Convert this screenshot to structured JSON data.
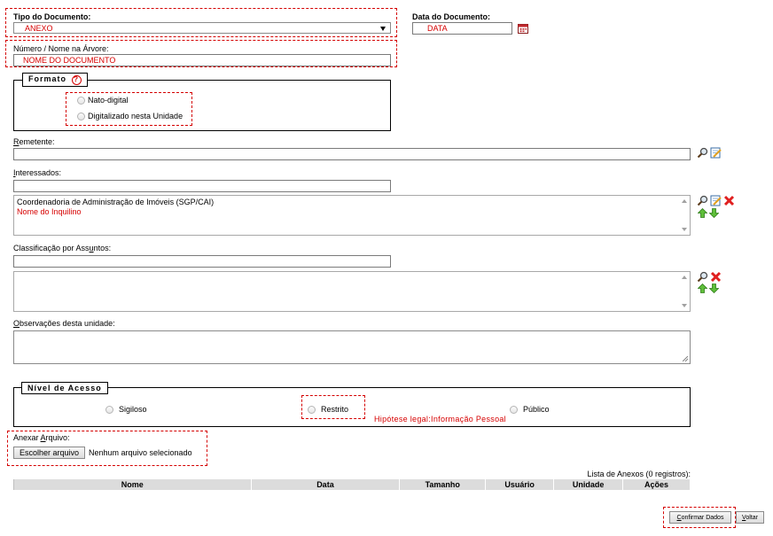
{
  "documento": {
    "tipo_label": "Tipo do Documento:",
    "tipo_value": "ANEXO",
    "data_label": "Data do Documento:",
    "data_value": "DATA",
    "numero_label": "Número / Nome na Árvore:",
    "numero_value": "NOME DO DOCUMENTO"
  },
  "formato": {
    "legend": "Formato",
    "help_symbol": "?",
    "options": [
      "Nato-digital",
      "Digitalizado nesta Unidade"
    ]
  },
  "remetente": {
    "label": "Remetente:"
  },
  "interessados": {
    "label": "Interessados:",
    "items": [
      "Coordenadoria de Administração de Imóveis (SGP/CAI)",
      "Nome do Inquilino"
    ]
  },
  "classificacao": {
    "label": "Classificação por Assuntos:"
  },
  "observacoes": {
    "label": "Observações desta unidade:"
  },
  "nivel_acesso": {
    "legend": "Nível de Acesso",
    "options": [
      "Sigiloso",
      "Restrito",
      "Público"
    ],
    "hipotese": "Hipótese legal:Informação Pessoal"
  },
  "anexo": {
    "label": "Anexar Arquivo:",
    "button": "Escolher arquivo",
    "status": "Nenhum arquivo selecionado",
    "lista_caption": "Lista de Anexos (0 registros):",
    "columns": [
      "Nome",
      "Data",
      "Tamanho",
      "Usuário",
      "Unidade",
      "Ações"
    ]
  },
  "actions": {
    "confirmar": "Confirmar Dados",
    "voltar": "Voltar"
  },
  "colors": {
    "annotation": "#d40000",
    "red_text": "#d60000",
    "header_bg": "#dcdcdc"
  },
  "icons": {
    "calendar": "calendar-icon",
    "search": "search-icon",
    "edit": "edit-icon",
    "remove": "remove-icon",
    "up": "arrow-up-icon",
    "down": "arrow-down-icon"
  }
}
